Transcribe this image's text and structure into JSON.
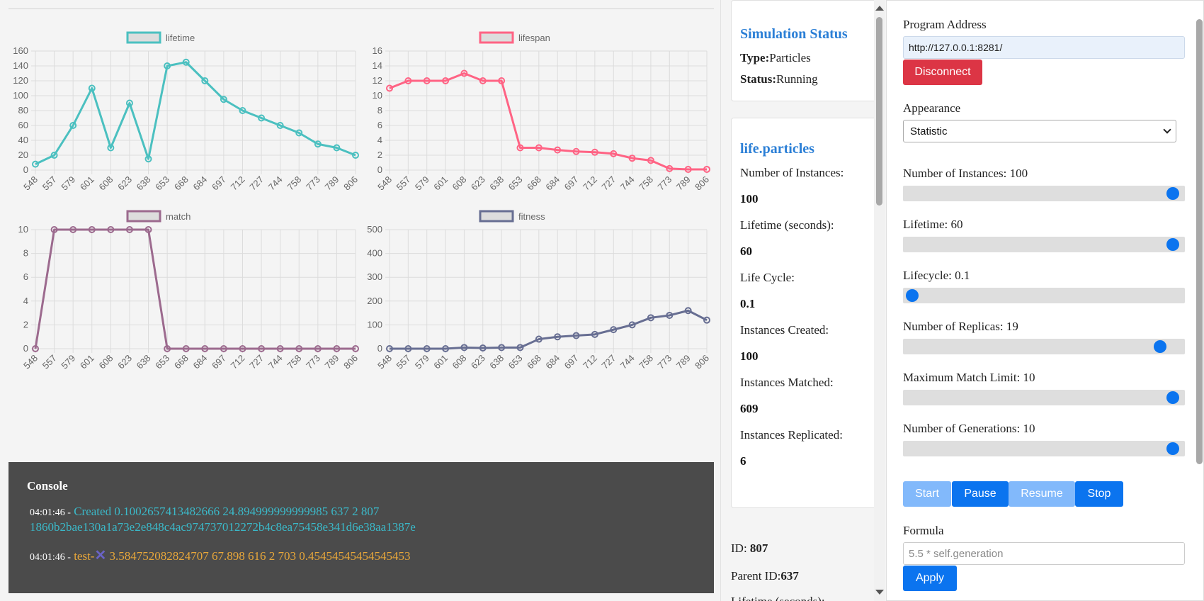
{
  "charts": [
    {
      "name": "lifetime",
      "legend": "lifetime",
      "color": "#4bc0c0",
      "y_ticks": [
        "160",
        "140",
        "120",
        "100",
        "80",
        "60",
        "40",
        "20",
        "0"
      ],
      "ylim": [
        0,
        160
      ],
      "x_ticks": [
        "548",
        "557",
        "579",
        "601",
        "608",
        "623",
        "638",
        "653",
        "668",
        "684",
        "697",
        "712",
        "727",
        "744",
        "758",
        "773",
        "789",
        "806"
      ]
    },
    {
      "name": "lifespan",
      "legend": "lifespan",
      "color": "#ff6384",
      "y_ticks": [
        "16",
        "14",
        "12",
        "10",
        "8",
        "6",
        "4",
        "2",
        "0"
      ],
      "ylim": [
        0,
        16
      ],
      "x_ticks": [
        "548",
        "557",
        "579",
        "601",
        "608",
        "623",
        "638",
        "653",
        "668",
        "684",
        "697",
        "712",
        "727",
        "744",
        "758",
        "773",
        "789",
        "806"
      ]
    },
    {
      "name": "match",
      "legend": "match",
      "color": "#9c6a8e",
      "y_ticks": [
        "10",
        "8",
        "6",
        "4",
        "2",
        "0"
      ],
      "ylim": [
        0,
        10
      ],
      "x_ticks": [
        "548",
        "557",
        "579",
        "601",
        "608",
        "623",
        "638",
        "653",
        "668",
        "684",
        "697",
        "712",
        "727",
        "744",
        "758",
        "773",
        "789",
        "806"
      ]
    },
    {
      "name": "fitness",
      "legend": "fitness",
      "color": "#676e92",
      "y_ticks": [
        "500",
        "400",
        "300",
        "200",
        "100",
        "0"
      ],
      "ylim": [
        0,
        500
      ],
      "x_ticks": [
        "548",
        "557",
        "579",
        "601",
        "608",
        "623",
        "638",
        "653",
        "668",
        "684",
        "697",
        "712",
        "727",
        "744",
        "758",
        "773",
        "789",
        "806"
      ]
    }
  ],
  "chart_data": [
    {
      "type": "line",
      "title": "",
      "categories": [
        "548",
        "557",
        "579",
        "601",
        "608",
        "623",
        "638",
        "653",
        "668",
        "684",
        "697",
        "712",
        "727",
        "744",
        "758",
        "773",
        "789",
        "806"
      ],
      "series": [
        {
          "name": "lifetime",
          "values": [
            8,
            20,
            60,
            110,
            30,
            90,
            15,
            140,
            145,
            120,
            95,
            80,
            70,
            60,
            50,
            35,
            30,
            20
          ]
        }
      ],
      "ylim": [
        0,
        160
      ]
    },
    {
      "type": "line",
      "title": "",
      "categories": [
        "548",
        "557",
        "579",
        "601",
        "608",
        "623",
        "638",
        "653",
        "668",
        "684",
        "697",
        "712",
        "727",
        "744",
        "758",
        "773",
        "789",
        "806"
      ],
      "series": [
        {
          "name": "lifespan",
          "values": [
            11,
            12,
            12,
            12,
            13,
            12,
            12,
            3,
            3,
            2.7,
            2.5,
            2.4,
            2.2,
            1.6,
            1.3,
            0.2,
            0.1,
            0.1
          ]
        }
      ],
      "ylim": [
        0,
        16
      ]
    },
    {
      "type": "line",
      "title": "",
      "categories": [
        "548",
        "557",
        "579",
        "601",
        "608",
        "623",
        "638",
        "653",
        "668",
        "684",
        "697",
        "712",
        "727",
        "744",
        "758",
        "773",
        "789",
        "806"
      ],
      "series": [
        {
          "name": "match",
          "values": [
            0,
            10,
            10,
            10,
            10,
            10,
            10,
            0,
            0,
            0,
            0,
            0,
            0,
            0,
            0,
            0,
            0,
            0
          ]
        }
      ],
      "ylim": [
        0,
        10
      ]
    },
    {
      "type": "line",
      "title": "",
      "categories": [
        "548",
        "557",
        "579",
        "601",
        "608",
        "623",
        "638",
        "653",
        "668",
        "684",
        "697",
        "712",
        "727",
        "744",
        "758",
        "773",
        "789",
        "806"
      ],
      "series": [
        {
          "name": "fitness",
          "values": [
            0,
            0,
            0,
            0,
            5,
            3,
            5,
            5,
            40,
            50,
            55,
            60,
            80,
            100,
            130,
            140,
            160,
            120
          ]
        }
      ],
      "ylim": [
        0,
        500
      ]
    }
  ],
  "console": {
    "title": "Console",
    "lines": [
      {
        "time": "04:01:46 -",
        "text": "Created 0.1002657413482666 24.894999999999985 637 2 807 1860b2bae130a1a73e2e848c4ac974737012272b4c8ea75458e341d6e38aa1387e"
      },
      {
        "time": "04:01:46 -",
        "prefix": "test-",
        "icon": "x-icon",
        "text": "3.584752082824707 67.898 616 2 703 0.45454545454545453"
      }
    ]
  },
  "status": {
    "title": "Simulation Status",
    "type_label": "Type:",
    "type_value": "Particles",
    "status_label": "Status:",
    "status_value": "Running"
  },
  "particles": {
    "title": "life.particles",
    "stats": [
      {
        "label": "Number of Instances:",
        "value": "100"
      },
      {
        "label": "Lifetime (seconds):",
        "value": "60"
      },
      {
        "label": "Life Cycle:",
        "value": "0.1"
      },
      {
        "label": "Instances Created:",
        "value": "100"
      },
      {
        "label": "Instances Matched:",
        "value": "609"
      },
      {
        "label": "Instances Replicated:",
        "value": "6"
      }
    ]
  },
  "detail": {
    "id_label": "ID: ",
    "id_value": "807",
    "parent_label": "Parent ID:",
    "parent_value": "637",
    "lifetime_label": "Lifetime (seconds):"
  },
  "panel": {
    "address_label": "Program Address",
    "address_value": "http://127.0.0.1:8281/",
    "disconnect_label": "Disconnect",
    "appearance_label": "Appearance",
    "appearance_value": "Statistic",
    "sliders": [
      {
        "label": "Number of Instances: 100",
        "level": 1.0
      },
      {
        "label": "Lifetime: 60",
        "level": 1.0
      },
      {
        "label": "Lifecycle: 0.1",
        "level": 0.0
      },
      {
        "label": "Number of Replicas: 19",
        "level": 0.95
      },
      {
        "label": "Maximum Match Limit: 10",
        "level": 1.0
      },
      {
        "label": "Number of Generations: 10",
        "level": 1.0
      }
    ],
    "start_label": "Start",
    "pause_label": "Pause",
    "resume_label": "Resume",
    "stop_label": "Stop",
    "formula_label": "Formula",
    "formula_placeholder": "5.5 * self.generation",
    "apply_label": "Apply"
  }
}
